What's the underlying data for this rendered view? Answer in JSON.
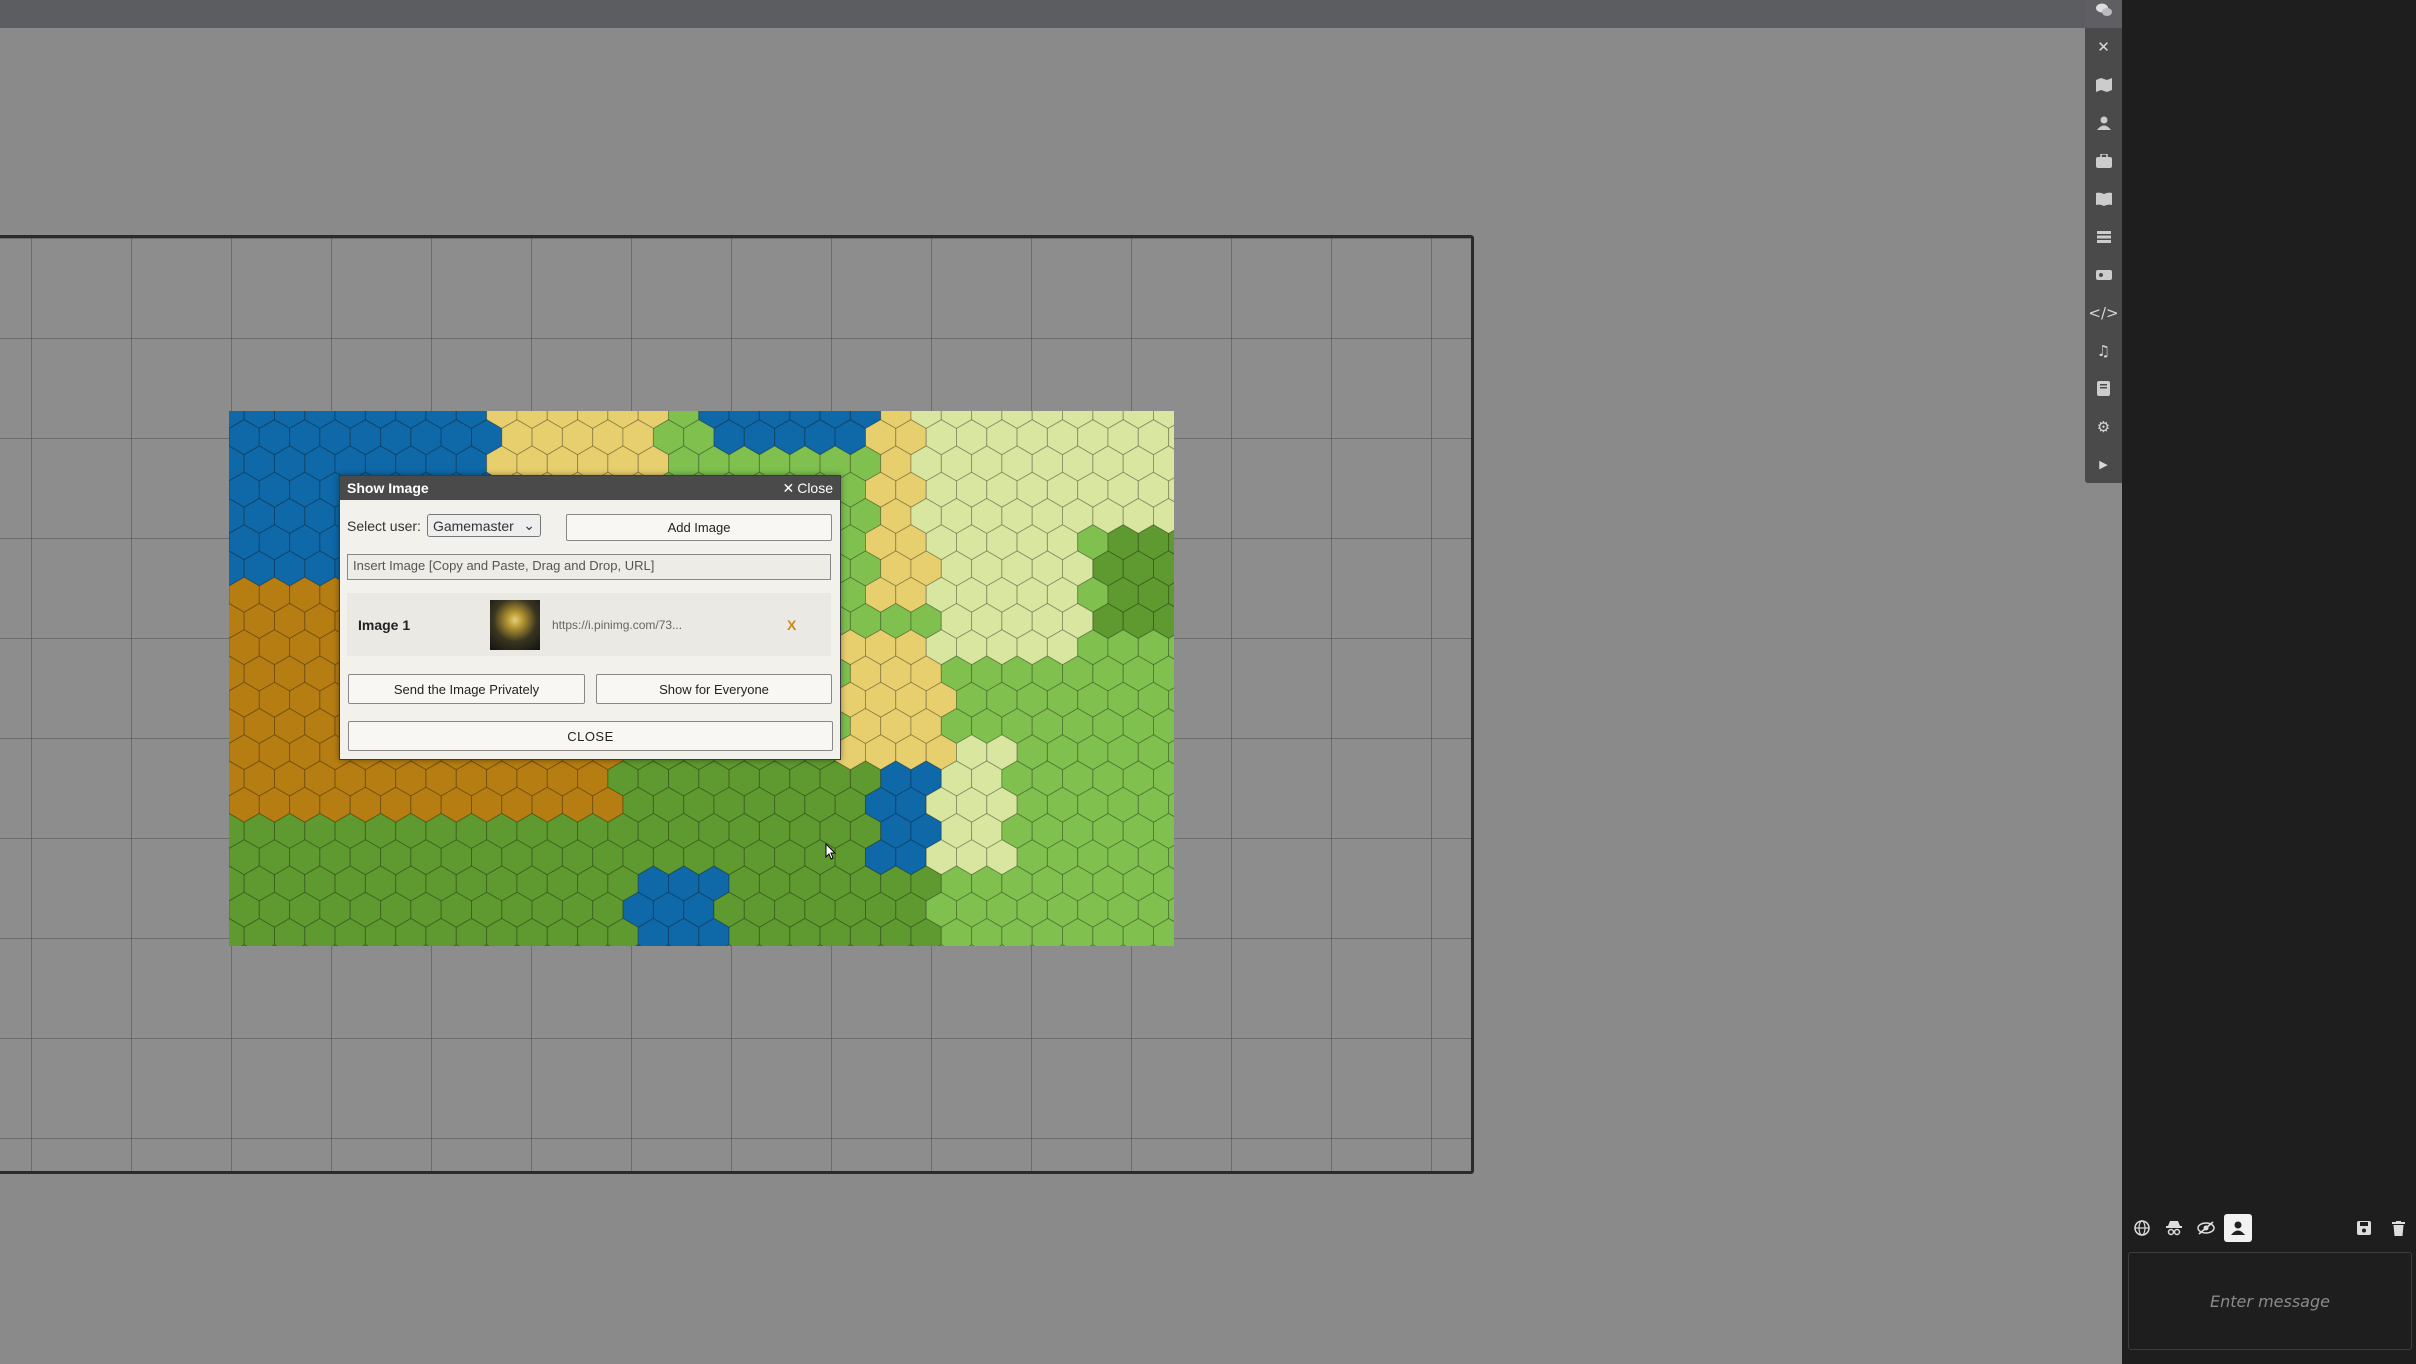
{
  "dialog": {
    "title": "Show Image",
    "close_link": "Close",
    "select_label": "Select user:",
    "select_value": "Gamemaster",
    "add_image": "Add Image",
    "insert_placeholder": "Insert Image [Copy and Paste, Drag and Drop, URL]",
    "images": [
      {
        "label": "Image 1",
        "url": "https://i.pinimg.com/73...",
        "remove": "X"
      }
    ],
    "send_privately": "Send the Image Privately",
    "show_everyone": "Show for Everyone",
    "close_button": "CLOSE"
  },
  "toolbar": {
    "tools": [
      "chat-icon",
      "close-icon",
      "map-icon",
      "user-icon",
      "inventory-icon",
      "book-icon",
      "list-icon",
      "tag-icon",
      "code-icon",
      "music-icon",
      "notes-icon",
      "settings-icon",
      "expand-icon"
    ]
  },
  "chat": {
    "placeholder": "Enter message",
    "mode_icons": [
      "globe-icon",
      "spy-icon",
      "eye-slash-icon",
      "user-icon"
    ],
    "active_mode": "user-icon"
  },
  "colors": {
    "ocean": "#0f68a8",
    "grass": "#7fc04f",
    "forest": "#5e9a2f",
    "desert": "#e8cf6e",
    "plains": "#d8e6a0",
    "hills": "#b67d12"
  }
}
